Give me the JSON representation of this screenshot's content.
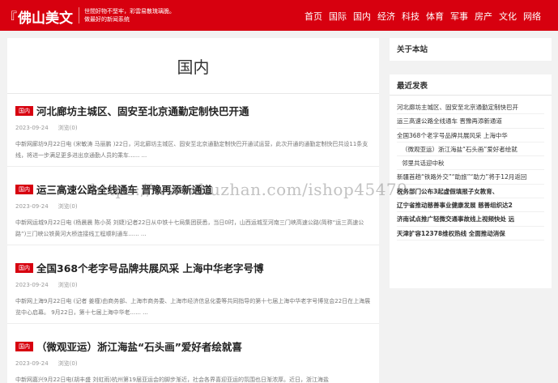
{
  "header": {
    "logo_bracket": "『",
    "logo_text": "佛山美文",
    "slogan_line1": "世間好物不堅牢，彩雲易散琉璃脆。",
    "slogan_line2": "做最好的新闻系统",
    "nav": [
      "首页",
      "国际",
      "国内",
      "经济",
      "科技",
      "体育",
      "军事",
      "房产",
      "文化",
      "网络"
    ]
  },
  "main": {
    "title": "国内",
    "articles": [
      {
        "badge": "国内",
        "title": "河北廊坊主城区、固安至北京通勤定制快巴开通",
        "date": "2023-09-24",
        "views": "浏览(0)",
        "summary": "中新网廊坊9月22日电 (宋敏涛 马丽鹏 )22日，河北廊坊主城区、固安至北京通勤定制快巴开通试运营，此次开通的通勤定制快巴共设11条支线，将进一步满足更多进出京通勤人员的乘车...... ..."
      },
      {
        "badge": "国内",
        "title": "运三高速公路全线通车 晋豫再添新通道",
        "date": "2023-09-24",
        "views": "浏览(0)",
        "summary": "中新网运城9月22日电 (杨晨晨 陈小英 刘婕)记者22日从中铁十七局集团获悉，当日0时，山西运城至河南三门峡高速公路(简称“运三高速公路”)三门峡公铁黄河大桥连接线工程顺利通车...... ..."
      },
      {
        "badge": "国内",
        "title": "全国368个老字号品牌共展风采 上海中华老字号博",
        "date": "2023-09-24",
        "views": "浏览(0)",
        "summary": "中新网上海9月22日电 (记者 姜槿)由商务部、上海市商务委、上海市经济信息化委等共同指导的第十七届上海中华老字号博览会22日在上海展览中心启幕。 9月22日，第十七届上海中华老...... ..."
      },
      {
        "badge": "国内",
        "title": "（微观亚运）浙江海盐“石头画”爱好者绘就喜",
        "date": "2023-09-24",
        "views": "浏览(0)",
        "summary": "中新网嘉兴9月22日电(胡丰盛 刘虹雨)杭州第19届亚运会的脚步渐近，社会各界喜迎亚运的氛围也日渐浓厚。近日，浙江海盐"
      }
    ]
  },
  "sidebar": {
    "about_title": "关于本站",
    "recent_title": "最近发表",
    "recent": [
      "河北廊坊主城区、固安至北京通勤定制快巴开",
      "运三高速公路全线通车 晋豫再添新通道",
      "全国368个老字号品牌共展风采 上海中华",
      "（微观亚运）浙江海盐“石头画”爱好者绘就",
      "邻里共话迎中秋",
      "新疆首趟“铁路外交”“助旅”“助力”将于12月返回",
      "税务部门公布3起虚假填报子女教育、",
      "辽宁省推动慈善事业健康发展 慈善组织达2",
      "济南试点推广轻微交通事故线上视频快处 远",
      "天津扩容12378维权热线 全面推动消保"
    ]
  },
  "watermark": "https://www.huzhan.com/ishop45479"
}
